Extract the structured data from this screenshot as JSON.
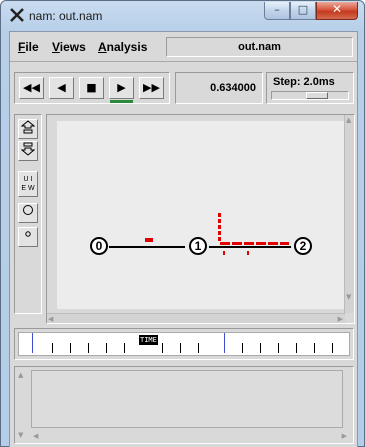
{
  "window": {
    "title": "nam: out.nam",
    "caption_buttons": {
      "minimize": "–",
      "maximize": "□",
      "close": "✕"
    }
  },
  "menu": {
    "file": "File",
    "views": "Views",
    "analysis": "Analysis",
    "filename": "out.nam"
  },
  "controls": {
    "rewind": "◀◀",
    "back": "◀",
    "stop": "■",
    "play": "▶",
    "fast_forward": "▶▶",
    "time": "0.634000",
    "step_label": "Step: 2.0ms"
  },
  "tools": {
    "zoom_in_icon": "zoom-in-icon",
    "zoom_out_icon": "zoom-out-icon",
    "view_label_1": "U I",
    "view_label_2": "E W"
  },
  "network": {
    "nodes": [
      "0",
      "1",
      "2"
    ]
  },
  "timeline": {
    "marker": "TIME"
  },
  "colors": {
    "packet": "#e00000",
    "timeline_marker": "#3a4fd6",
    "play_indicator": "#2a8a3a"
  }
}
